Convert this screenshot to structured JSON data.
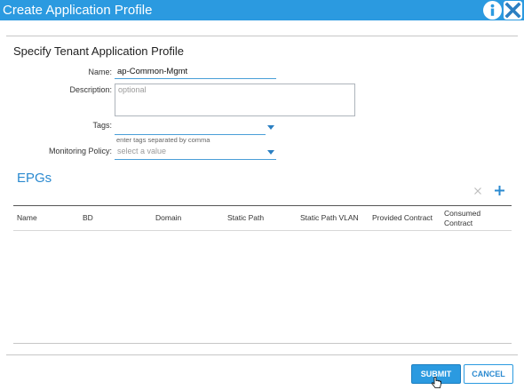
{
  "dialog": {
    "title": "Create Application Profile",
    "info_icon": "info-icon",
    "close_icon": "close-icon"
  },
  "form": {
    "section_title": "Specify Tenant Application Profile",
    "name_label": "Name:",
    "name_value": "ap-Common-Mgmt",
    "description_label": "Description:",
    "description_placeholder": "optional",
    "tags_label": "Tags:",
    "tags_hint": "enter tags separated by comma",
    "monitoring_label": "Monitoring Policy:",
    "monitoring_placeholder": "select a value"
  },
  "epgs": {
    "title": "EPGs",
    "delete_icon": "x-icon",
    "add_icon": "plus-icon",
    "columns": [
      "Name",
      "BD",
      "Domain",
      "Static Path",
      "Static Path VLAN",
      "Provided Contract",
      "Consumed Contract"
    ]
  },
  "footer": {
    "submit_label": "SUBMIT",
    "cancel_label": "CANCEL"
  },
  "colors": {
    "titlebar": "#2b9ae0",
    "accent": "#2b8ad0"
  }
}
